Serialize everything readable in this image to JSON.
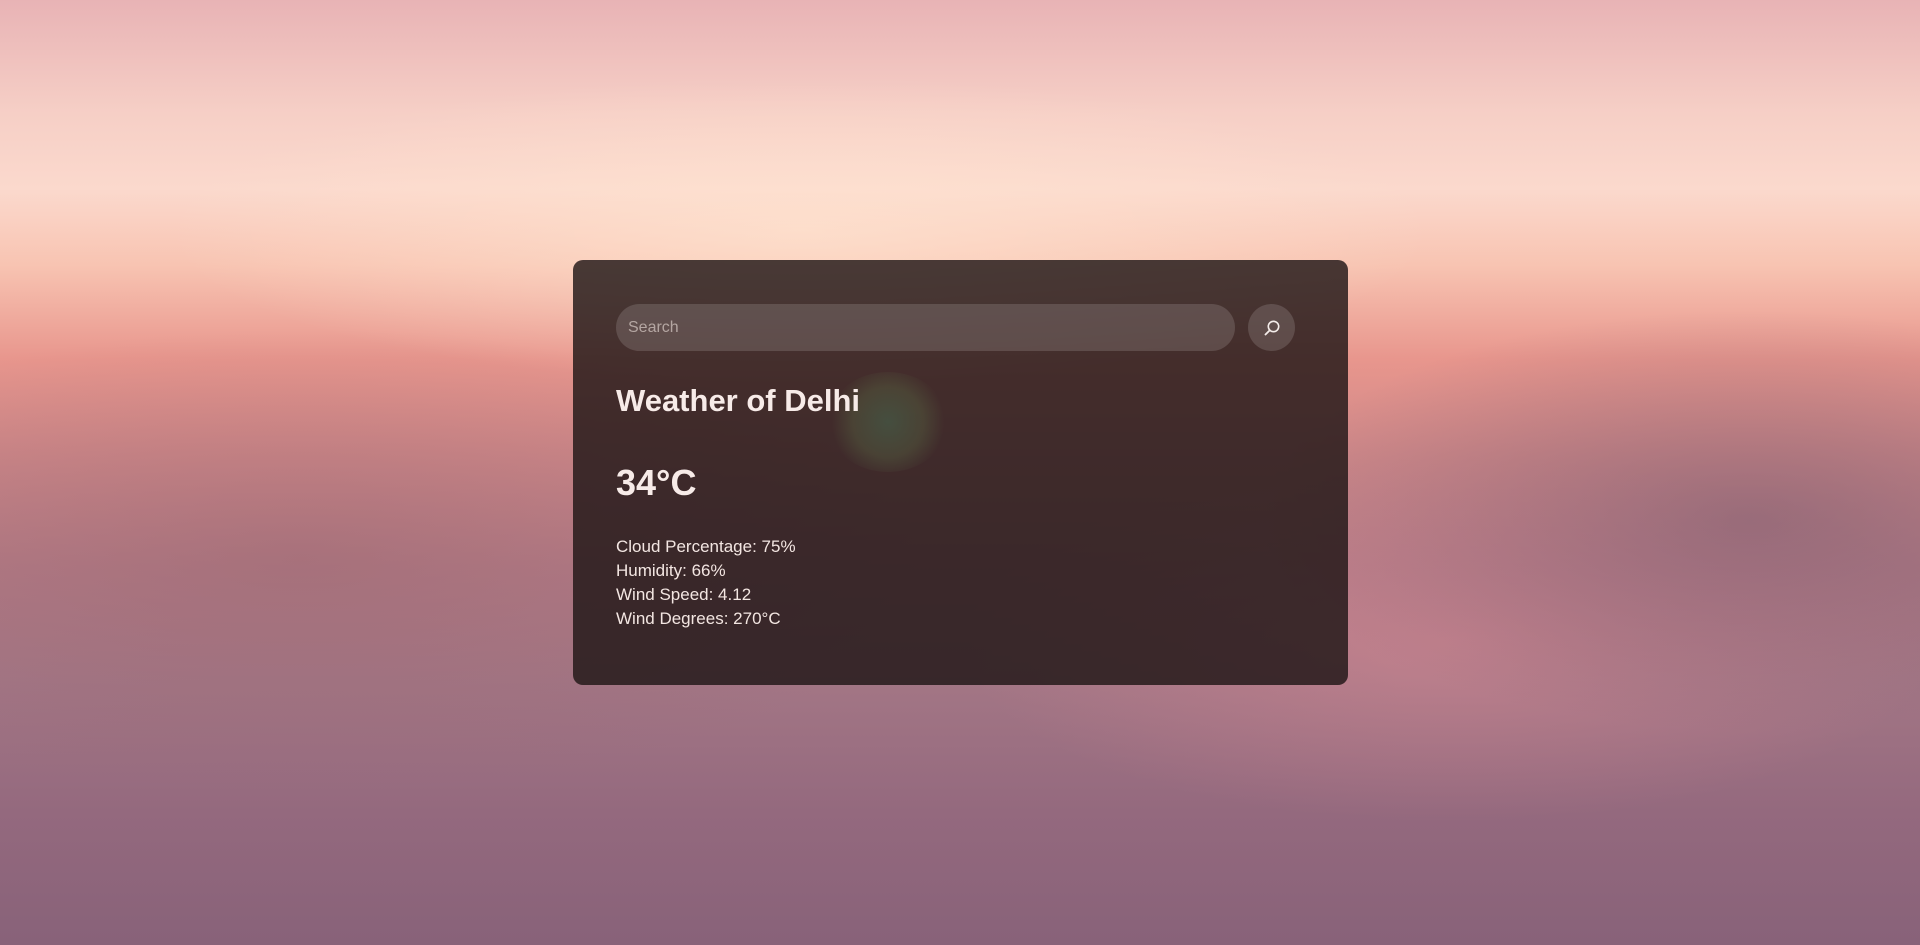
{
  "search": {
    "placeholder": "Search",
    "button_icon": "search-icon"
  },
  "weather": {
    "title": "Weather of Delhi",
    "temperature": "34°C",
    "details": {
      "cloud_percentage": "Cloud Percentage: 75%",
      "humidity": "Humidity: 66%",
      "wind_speed": "Wind Speed: 4.12",
      "wind_degrees": "Wind Degrees: 270°C"
    }
  },
  "colors": {
    "card_background": "#201616",
    "text": "#f7ebe8",
    "sky_top": "#e8b3b5",
    "sky_glow": "#fbd9cd",
    "cloud": "#a37685"
  }
}
